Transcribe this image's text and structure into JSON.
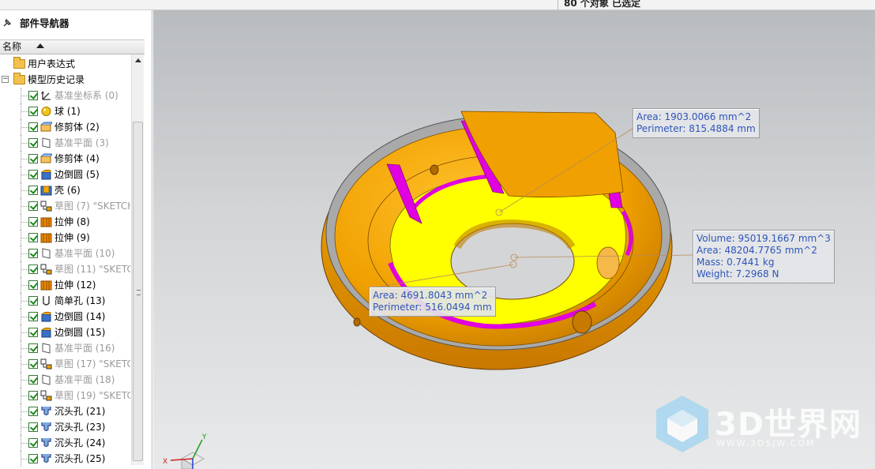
{
  "topbar": {
    "selection_status": "80 个对象 已选定"
  },
  "navigator": {
    "title": "部件导航器",
    "column_name": "名称",
    "tree": [
      {
        "label": "用户表达式",
        "icon": "folder-icon",
        "level": 0,
        "gray": false
      },
      {
        "label": "模型历史记录",
        "icon": "folder-open-icon",
        "level": 0,
        "expanded": true,
        "gray": false
      },
      {
        "label": "基准坐标系 (0)",
        "icon": "datum-csys-icon",
        "level": 1,
        "gray": true
      },
      {
        "label": "球 (1)",
        "icon": "sphere-icon",
        "level": 1,
        "gray": false
      },
      {
        "label": "修剪体 (2)",
        "icon": "trim-body-icon",
        "level": 1,
        "gray": false
      },
      {
        "label": "基准平面 (3)",
        "icon": "datum-plane-icon",
        "level": 1,
        "gray": true
      },
      {
        "label": "修剪体 (4)",
        "icon": "trim-body-icon",
        "level": 1,
        "gray": false
      },
      {
        "label": "边倒圆 (5)",
        "icon": "edge-blend-icon",
        "level": 1,
        "gray": false
      },
      {
        "label": "壳 (6)",
        "icon": "shell-icon",
        "level": 1,
        "gray": false
      },
      {
        "label": "草图 (7) \"SKETCH",
        "icon": "sketch-icon",
        "level": 1,
        "gray": true
      },
      {
        "label": "拉伸 (8)",
        "icon": "extrude-icon",
        "level": 1,
        "gray": false
      },
      {
        "label": "拉伸 (9)",
        "icon": "extrude-icon",
        "level": 1,
        "gray": false
      },
      {
        "label": "基准平面 (10)",
        "icon": "datum-plane-icon",
        "level": 1,
        "gray": true
      },
      {
        "label": "草图 (11) \"SKETC",
        "icon": "sketch-icon",
        "level": 1,
        "gray": true
      },
      {
        "label": "拉伸 (12)",
        "icon": "extrude-icon",
        "level": 1,
        "gray": false
      },
      {
        "label": "简单孔 (13)",
        "icon": "simple-hole-icon",
        "level": 1,
        "gray": false
      },
      {
        "label": "边倒圆 (14)",
        "icon": "edge-blend-icon",
        "level": 1,
        "gray": false
      },
      {
        "label": "边倒圆 (15)",
        "icon": "edge-blend-icon",
        "level": 1,
        "gray": false
      },
      {
        "label": "基准平面 (16)",
        "icon": "datum-plane-icon",
        "level": 1,
        "gray": true
      },
      {
        "label": "草图 (17) \"SKETC",
        "icon": "sketch-icon",
        "level": 1,
        "gray": true
      },
      {
        "label": "基准平面 (18)",
        "icon": "datum-plane-icon",
        "level": 1,
        "gray": true
      },
      {
        "label": "草图 (19) \"SKETC",
        "icon": "sketch-icon",
        "level": 1,
        "gray": true
      },
      {
        "label": "沉头孔 (21)",
        "icon": "counterbore-hole-icon",
        "level": 1,
        "gray": false
      },
      {
        "label": "沉头孔 (23)",
        "icon": "counterbore-hole-icon",
        "level": 1,
        "gray": false
      },
      {
        "label": "沉头孔 (24)",
        "icon": "counterbore-hole-icon",
        "level": 1,
        "gray": false
      },
      {
        "label": "沉头孔 (25)",
        "icon": "counterbore-hole-icon",
        "level": 1,
        "gray": false
      }
    ]
  },
  "callouts": {
    "top": {
      "line1": "Area: 1903.0066 mm^2",
      "line2": "Perimeter: 815.4884 mm"
    },
    "right": {
      "line1": "Volume: 95019.1667 mm^3",
      "line2": "Area: 48204.7765 mm^2",
      "line3": "Mass: 0.7441 kg",
      "line4": "Weight: 7.2968 N"
    },
    "left": {
      "line1": "Area: 4691.8043 mm^2",
      "line2": "Perimeter: 516.0494 mm"
    }
  },
  "triad": {
    "x_label": "X",
    "y_label": "Y"
  },
  "watermark": {
    "brand": "3D世界网",
    "url": "WWW.3DSJW.COM"
  },
  "colors": {
    "part_orange": "#f0a000",
    "face_yellow": "#ffff00",
    "face_magenta": "#e000e0",
    "callout_text": "#2f55b8"
  }
}
